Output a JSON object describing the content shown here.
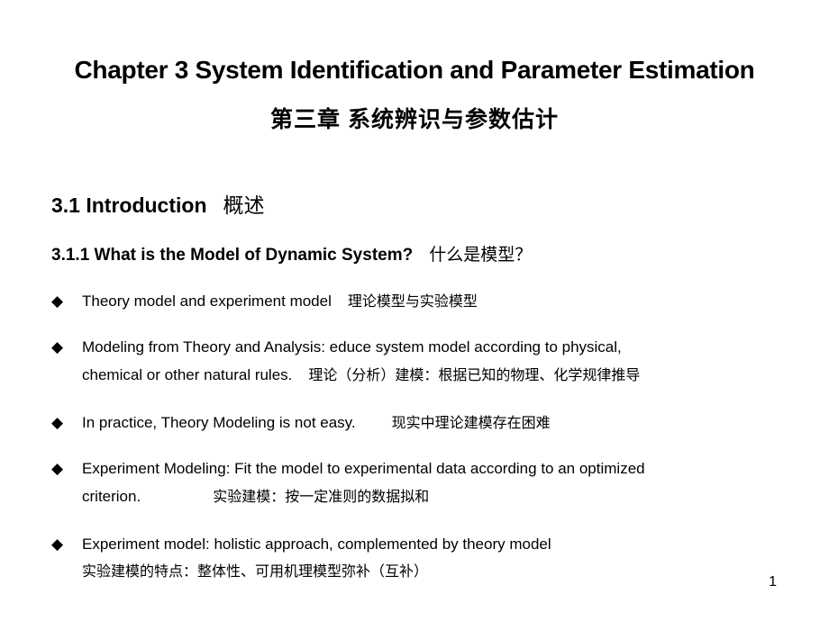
{
  "slide": {
    "title_en": "Chapter 3   System Identification and Parameter Estimation",
    "title_zh": "第三章  系统辨识与参数估计",
    "section": {
      "en": "3.1 Introduction",
      "zh": "概述"
    },
    "subsection": {
      "en": "3.1.1 What is the Model of Dynamic System?",
      "zh": "什么是模型？"
    },
    "bullet_icon": "diamond-bullet-icon",
    "bullet_glyph": "◆",
    "bullets": [
      {
        "line1_en": "Theory model and experiment  model",
        "line1_zh": "理论模型与实验模型"
      },
      {
        "line1_en": "Modeling  from  Theory  and  Analysis:  educe  system  model  according  to  physical,",
        "line2_en": "chemical   or other natural  rules.",
        "line2_zh": "理论（分析）建模：根据已知的物理、化学规律推导"
      },
      {
        "line1_en": "In practice, Theory Modeling  is not easy.",
        "line1_zh": "现实中理论建模存在困难"
      },
      {
        "line1_en": "Experiment  Modeling:  Fit  the model to experimental  data according  to an  optimized",
        "line2_en": "criterion.",
        "line2_zh": "实验建模：按一定准则的数据拟和"
      },
      {
        "line1_en": "Experiment  model:  holistic  approach,  complemented  by theory model",
        "line2_zh": "实验建模的特点：整体性、可用机理模型弥补（互补）"
      }
    ],
    "page_number": "1"
  }
}
